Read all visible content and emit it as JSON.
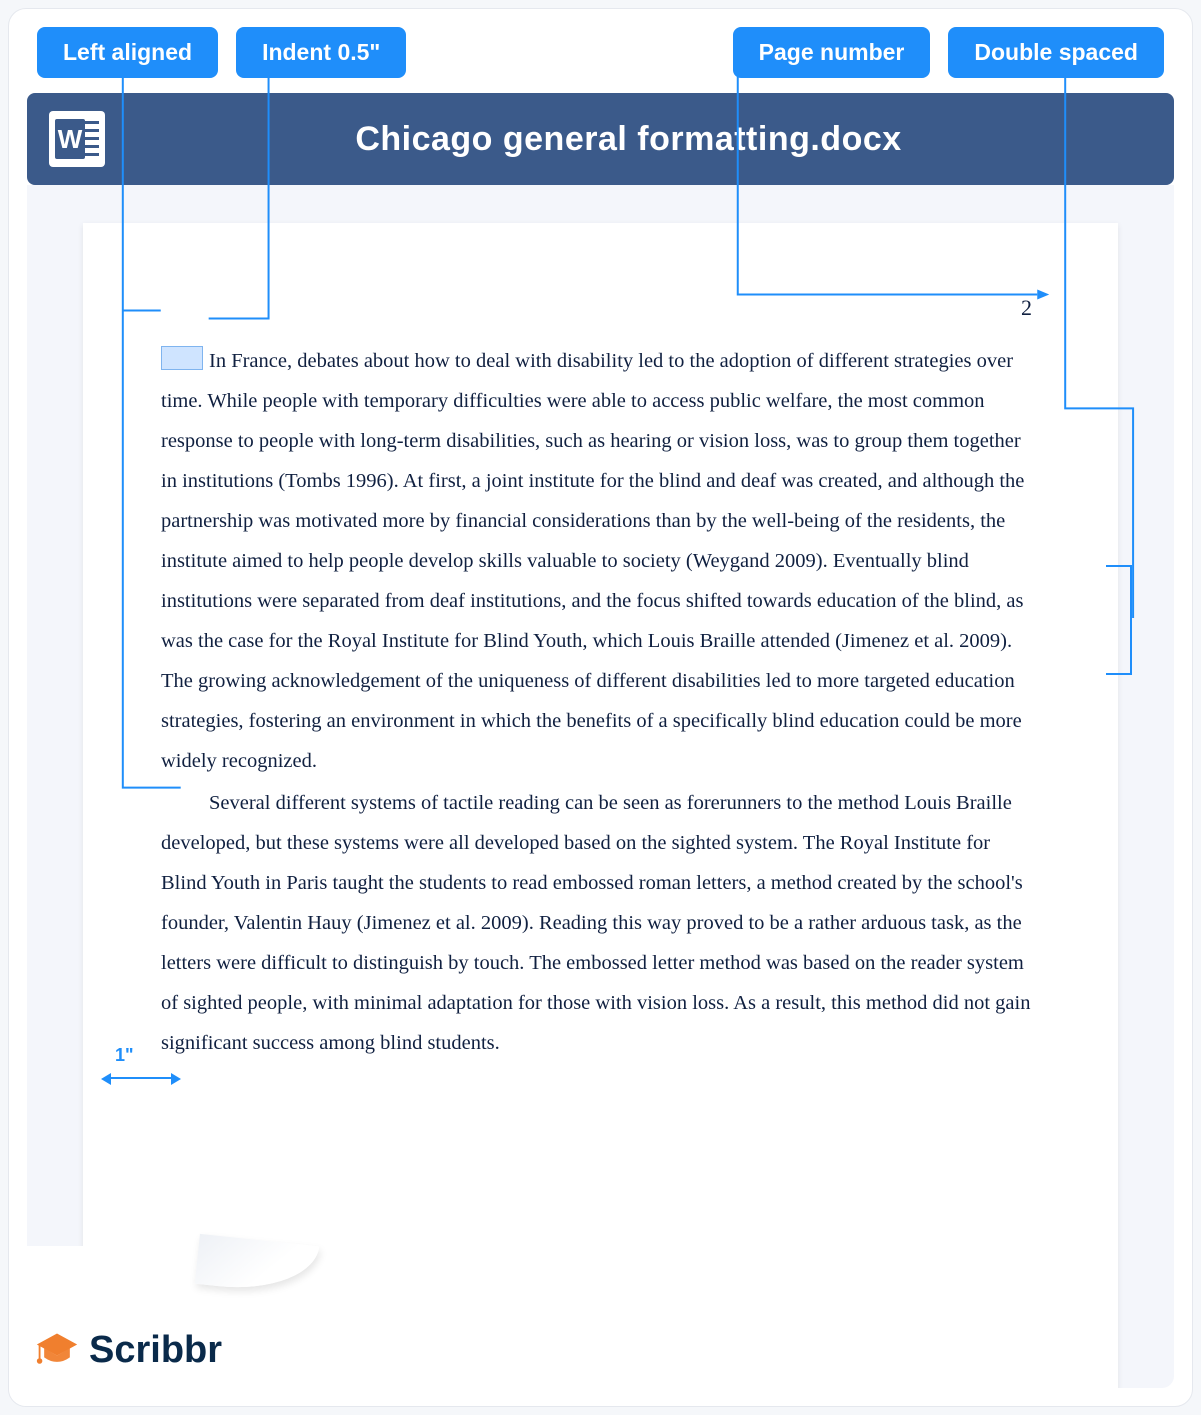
{
  "callouts": {
    "left_aligned": "Left aligned",
    "indent": "Indent 0.5\"",
    "page_number": "Page number",
    "double_spaced": "Double spaced"
  },
  "titlebar": {
    "document_name": "Chicago general formatting.docx"
  },
  "page": {
    "number": "2",
    "paragraph1": "In France, debates about how to deal with disability led to the adoption of different strategies over time. While people with temporary difficulties were able to access public welfare, the most common response to people with long-term disabilities, such as hearing or vision loss, was to group them together in institutions (Tombs 1996). At first, a joint institute for the blind and deaf was created, and although the partnership was motivated more by financial considerations than by the well-being of the residents, the institute aimed to help people develop skills valuable to society (Weygand 2009). Eventually blind institutions were separated from deaf institutions, and the focus shifted towards education of the blind, as was the case for the Royal Institute for Blind Youth, which Louis Braille attended (Jimenez et al. 2009). The growing acknowledgement of the uniqueness of different disabilities led to more targeted education strategies, fostering an environment in which the benefits of a specifically blind education could be more widely recognized.",
    "paragraph2": "Several different systems of tactile reading can be seen as forerunners to the method Louis Braille developed, but these systems were all developed based on the sighted system. The Royal Institute for Blind Youth in Paris taught the students to read embossed roman letters, a method created by the school's founder, Valentin Hauy (Jimenez et al. 2009). Reading this way proved to be a rather arduous task, as the letters were difficult to distinguish by touch. The embossed letter method was based on the reader system of sighted people, with minimal adaptation for those with vision loss. As a result, this method did not gain significant success among blind students."
  },
  "margin_label": "1\"",
  "brand": "Scribbr"
}
